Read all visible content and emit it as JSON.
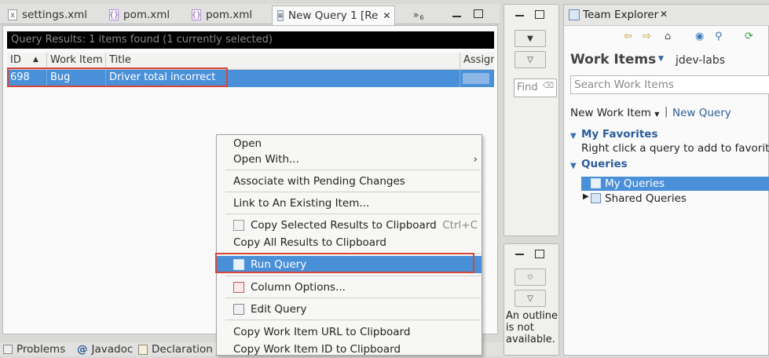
{
  "editor_tabs": [
    {
      "label": "settings.xml",
      "icon": "xml-file-icon"
    },
    {
      "label": "pom.xml",
      "icon": "maven-pom-icon"
    },
    {
      "label": "pom.xml",
      "icon": "maven-pom-icon"
    },
    {
      "label": "New Query 1 [Re",
      "icon": "query-file-icon"
    }
  ],
  "overflow_label": "»",
  "overflow_count": "6",
  "query_status": "Query Results: 1 items found (1 currently selected)",
  "grid": {
    "columns": [
      "ID",
      "Work Item",
      "Title",
      "Assign"
    ],
    "rows": [
      {
        "id": "698",
        "work_item": "Bug",
        "title": "Driver total incorrect",
        "assigned": ""
      }
    ]
  },
  "context_menu": [
    {
      "label": "Open",
      "mnemonic": "O"
    },
    {
      "label": "Open With...",
      "submenu": true
    },
    {
      "label": "Associate with Pending Changes"
    },
    {
      "label": "Link to An Existing Item..."
    },
    {
      "label": "Copy Selected Results to Clipboard",
      "shortcut": "Ctrl+C",
      "icon": "copy-icon"
    },
    {
      "label": "Copy All Results to Clipboard"
    },
    {
      "label": "Run Query",
      "icon": "run-query-icon",
      "selected": true
    },
    {
      "label": "Column Options...",
      "icon": "column-options-icon"
    },
    {
      "label": "Edit Query",
      "icon": "edit-query-icon"
    },
    {
      "label": "Copy Work Item URL to Clipboard"
    },
    {
      "label": "Copy Work Item ID to Clipboard"
    }
  ],
  "bottom_tabs": [
    {
      "label": "Problems",
      "icon": "problems-icon"
    },
    {
      "label": "Javadoc",
      "icon": "javadoc-icon"
    },
    {
      "label": "Declaration",
      "icon": "declaration-icon"
    }
  ],
  "outline": {
    "find_placeholder": "Find",
    "message": "An outline is not available."
  },
  "team_explorer": {
    "title": "Team Explorer",
    "section_title": "Work Items",
    "project": "jdev-labs",
    "search_placeholder": "Search Work Items",
    "new_work_item": "New Work Item",
    "new_query": "New Query",
    "favorites_title": "My Favorites",
    "favorites_hint": "Right click a query to add to favorites",
    "queries_title": "Queries",
    "tree": [
      {
        "label": "My Queries",
        "selected": true
      },
      {
        "label": "Shared Queries",
        "expandable": true
      }
    ]
  },
  "colors": {
    "selection": "#4a90d9",
    "highlight_border": "#d8463a",
    "link": "#2b5d9a"
  }
}
